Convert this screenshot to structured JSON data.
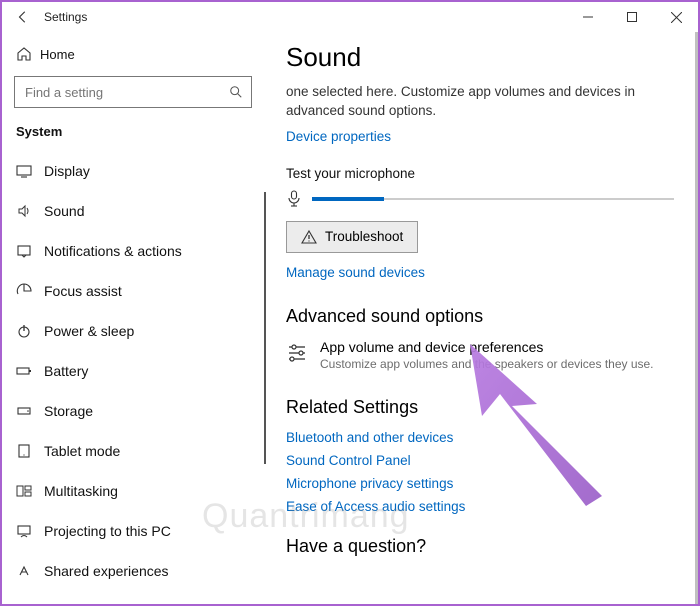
{
  "titlebar": {
    "title": "Settings"
  },
  "sidebar": {
    "home_label": "Home",
    "search_placeholder": "Find a setting",
    "category_label": "System",
    "items": [
      {
        "label": "Display"
      },
      {
        "label": "Sound"
      },
      {
        "label": "Notifications & actions"
      },
      {
        "label": "Focus assist"
      },
      {
        "label": "Power & sleep"
      },
      {
        "label": "Battery"
      },
      {
        "label": "Storage"
      },
      {
        "label": "Tablet mode"
      },
      {
        "label": "Multitasking"
      },
      {
        "label": "Projecting to this PC"
      },
      {
        "label": "Shared experiences"
      }
    ]
  },
  "main": {
    "heading": "Sound",
    "description": "one selected here. Customize app volumes and devices in advanced sound options.",
    "device_properties_link": "Device properties",
    "test_mic_label": "Test your microphone",
    "troubleshoot_label": "Troubleshoot",
    "manage_devices_link": "Manage sound devices",
    "advanced_heading": "Advanced sound options",
    "advanced_item_title": "App volume and device preferences",
    "advanced_item_sub": "Customize app volumes and the speakers or devices they use.",
    "related_heading": "Related Settings",
    "related_links": {
      "bluetooth": "Bluetooth and other devices",
      "control_panel": "Sound Control Panel",
      "mic_privacy": "Microphone privacy settings",
      "ease_access": "Ease of Access audio settings"
    },
    "question_heading": "Have a question?"
  },
  "watermark": "Quantrimang"
}
